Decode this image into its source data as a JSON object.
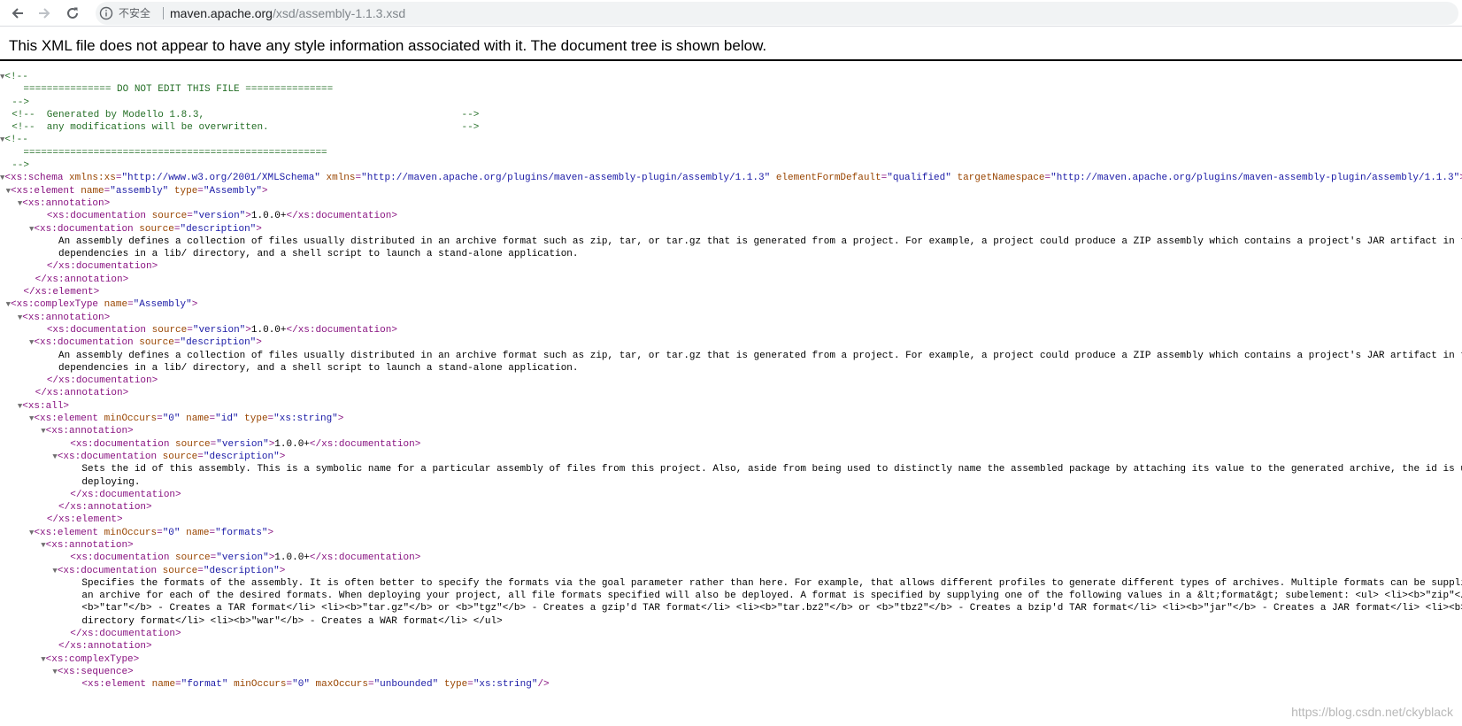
{
  "browser": {
    "back_icon": "arrow-left-icon",
    "forward_icon": "arrow-right-icon",
    "reload_icon": "reload-icon",
    "info_icon": "info-circle-icon",
    "security_label": "不安全",
    "url_host": "maven.apache.org",
    "url_path": "/xsd/assembly-1.1.3.xsd"
  },
  "viewer": {
    "header": "This XML file does not appear to have any style information associated with it. The document tree is shown below."
  },
  "xml_lines": [
    {
      "fold": true,
      "segments": [
        [
          "c",
          "<!--"
        ]
      ]
    },
    {
      "indent": "   ",
      "segments": [
        [
          "c",
          "=============== DO NOT EDIT THIS FILE ==============="
        ]
      ]
    },
    {
      "indent": " ",
      "segments": [
        [
          "c",
          "-->"
        ]
      ]
    },
    {
      "indent": " ",
      "segments": [
        [
          "c",
          "<!--  Generated by Modello 1.8.3,                                            -->"
        ]
      ]
    },
    {
      "indent": " ",
      "segments": [
        [
          "c",
          "<!--  any modifications will be overwritten.                                 -->"
        ]
      ]
    },
    {
      "fold": true,
      "segments": [
        [
          "c",
          "<!--"
        ]
      ]
    },
    {
      "indent": "   ",
      "segments": [
        [
          "c",
          "===================================================="
        ]
      ]
    },
    {
      "indent": " ",
      "segments": [
        [
          "c",
          "-->"
        ]
      ]
    },
    {
      "fold": true,
      "segments": [
        [
          "t",
          "<xs:schema"
        ],
        [
          "p",
          " "
        ],
        [
          "a",
          "xmlns:xs"
        ],
        [
          "t",
          "="
        ],
        [
          "v",
          "\"http://www.w3.org/2001/XMLSchema\""
        ],
        [
          "p",
          " "
        ],
        [
          "a",
          "xmlns"
        ],
        [
          "t",
          "="
        ],
        [
          "v",
          "\"http://maven.apache.org/plugins/maven-assembly-plugin/assembly/1.1.3\""
        ],
        [
          "p",
          " "
        ],
        [
          "a",
          "elementFormDefault"
        ],
        [
          "t",
          "="
        ],
        [
          "v",
          "\"qualified\""
        ],
        [
          "p",
          " "
        ],
        [
          "a",
          "targetNamespace"
        ],
        [
          "t",
          "="
        ],
        [
          "v",
          "\"http://maven.apache.org/plugins/maven-assembly-plugin/assembly/1.1.3\""
        ],
        [
          "t",
          ">"
        ]
      ]
    },
    {
      "indent": "  ",
      "fold": true,
      "segments": [
        [
          "t",
          "<xs:element"
        ],
        [
          "p",
          " "
        ],
        [
          "a",
          "name"
        ],
        [
          "t",
          "="
        ],
        [
          "v",
          "\"assembly\""
        ],
        [
          "p",
          " "
        ],
        [
          "a",
          "type"
        ],
        [
          "t",
          "="
        ],
        [
          "v",
          "\"Assembly\""
        ],
        [
          "t",
          ">"
        ]
      ]
    },
    {
      "indent": "    ",
      "fold": true,
      "segments": [
        [
          "t",
          "<xs:annotation>"
        ]
      ]
    },
    {
      "indent": "       ",
      "segments": [
        [
          "t",
          "<xs:documentation"
        ],
        [
          "p",
          " "
        ],
        [
          "a",
          "source"
        ],
        [
          "t",
          "="
        ],
        [
          "v",
          "\"version\""
        ],
        [
          "t",
          ">"
        ],
        [
          "p",
          "1.0.0+"
        ],
        [
          "t",
          "</xs:documentation>"
        ]
      ]
    },
    {
      "indent": "      ",
      "fold": true,
      "segments": [
        [
          "t",
          "<xs:documentation"
        ],
        [
          "p",
          " "
        ],
        [
          "a",
          "source"
        ],
        [
          "t",
          "="
        ],
        [
          "v",
          "\"description\""
        ],
        [
          "t",
          ">"
        ]
      ]
    },
    {
      "indent": "         ",
      "segments": [
        [
          "p",
          "An assembly defines a collection of files usually distributed in an archive format such as zip, tar, or tar.gz that is generated from a project. For example, a project could produce a ZIP assembly which contains a project's JAR artifact in the root directory, the runtime"
        ]
      ]
    },
    {
      "indent": "         ",
      "segments": [
        [
          "p",
          "dependencies in a lib/ directory, and a shell script to launch a stand-alone application."
        ]
      ]
    },
    {
      "indent": "       ",
      "segments": [
        [
          "t",
          "</xs:documentation>"
        ]
      ]
    },
    {
      "indent": "     ",
      "segments": [
        [
          "t",
          "</xs:annotation>"
        ]
      ]
    },
    {
      "indent": "   ",
      "segments": [
        [
          "t",
          "</xs:element>"
        ]
      ]
    },
    {
      "indent": "  ",
      "fold": true,
      "segments": [
        [
          "t",
          "<xs:complexType"
        ],
        [
          "p",
          " "
        ],
        [
          "a",
          "name"
        ],
        [
          "t",
          "="
        ],
        [
          "v",
          "\"Assembly\""
        ],
        [
          "t",
          ">"
        ]
      ]
    },
    {
      "indent": "    ",
      "fold": true,
      "segments": [
        [
          "t",
          "<xs:annotation>"
        ]
      ]
    },
    {
      "indent": "       ",
      "segments": [
        [
          "t",
          "<xs:documentation"
        ],
        [
          "p",
          " "
        ],
        [
          "a",
          "source"
        ],
        [
          "t",
          "="
        ],
        [
          "v",
          "\"version\""
        ],
        [
          "t",
          ">"
        ],
        [
          "p",
          "1.0.0+"
        ],
        [
          "t",
          "</xs:documentation>"
        ]
      ]
    },
    {
      "indent": "      ",
      "fold": true,
      "segments": [
        [
          "t",
          "<xs:documentation"
        ],
        [
          "p",
          " "
        ],
        [
          "a",
          "source"
        ],
        [
          "t",
          "="
        ],
        [
          "v",
          "\"description\""
        ],
        [
          "t",
          ">"
        ]
      ]
    },
    {
      "indent": "         ",
      "segments": [
        [
          "p",
          "An assembly defines a collection of files usually distributed in an archive format such as zip, tar, or tar.gz that is generated from a project. For example, a project could produce a ZIP assembly which contains a project's JAR artifact in the root directory, the runtime"
        ]
      ]
    },
    {
      "indent": "         ",
      "segments": [
        [
          "p",
          "dependencies in a lib/ directory, and a shell script to launch a stand-alone application."
        ]
      ]
    },
    {
      "indent": "       ",
      "segments": [
        [
          "t",
          "</xs:documentation>"
        ]
      ]
    },
    {
      "indent": "     ",
      "segments": [
        [
          "t",
          "</xs:annotation>"
        ]
      ]
    },
    {
      "indent": "    ",
      "fold": true,
      "segments": [
        [
          "t",
          "<xs:all>"
        ]
      ]
    },
    {
      "indent": "      ",
      "fold": true,
      "segments": [
        [
          "t",
          "<xs:element"
        ],
        [
          "p",
          " "
        ],
        [
          "a",
          "minOccurs"
        ],
        [
          "t",
          "="
        ],
        [
          "v",
          "\"0\""
        ],
        [
          "p",
          " "
        ],
        [
          "a",
          "name"
        ],
        [
          "t",
          "="
        ],
        [
          "v",
          "\"id\""
        ],
        [
          "p",
          " "
        ],
        [
          "a",
          "type"
        ],
        [
          "t",
          "="
        ],
        [
          "v",
          "\"xs:string\""
        ],
        [
          "t",
          ">"
        ]
      ]
    },
    {
      "indent": "        ",
      "fold": true,
      "segments": [
        [
          "t",
          "<xs:annotation>"
        ]
      ]
    },
    {
      "indent": "           ",
      "segments": [
        [
          "t",
          "<xs:documentation"
        ],
        [
          "p",
          " "
        ],
        [
          "a",
          "source"
        ],
        [
          "t",
          "="
        ],
        [
          "v",
          "\"version\""
        ],
        [
          "t",
          ">"
        ],
        [
          "p",
          "1.0.0+"
        ],
        [
          "t",
          "</xs:documentation>"
        ]
      ]
    },
    {
      "indent": "          ",
      "fold": true,
      "segments": [
        [
          "t",
          "<xs:documentation"
        ],
        [
          "p",
          " "
        ],
        [
          "a",
          "source"
        ],
        [
          "t",
          "="
        ],
        [
          "v",
          "\"description\""
        ],
        [
          "t",
          ">"
        ]
      ]
    },
    {
      "indent": "             ",
      "segments": [
        [
          "p",
          "Sets the id of this assembly. This is a symbolic name for a particular assembly of files from this project. Also, aside from being used to distinctly name the assembled package by attaching its value to the generated archive, the id is used as your artifact's classifier when"
        ]
      ]
    },
    {
      "indent": "             ",
      "segments": [
        [
          "p",
          "deploying."
        ]
      ]
    },
    {
      "indent": "           ",
      "segments": [
        [
          "t",
          "</xs:documentation>"
        ]
      ]
    },
    {
      "indent": "         ",
      "segments": [
        [
          "t",
          "</xs:annotation>"
        ]
      ]
    },
    {
      "indent": "       ",
      "segments": [
        [
          "t",
          "</xs:element>"
        ]
      ]
    },
    {
      "indent": "      ",
      "fold": true,
      "segments": [
        [
          "t",
          "<xs:element"
        ],
        [
          "p",
          " "
        ],
        [
          "a",
          "minOccurs"
        ],
        [
          "t",
          "="
        ],
        [
          "v",
          "\"0\""
        ],
        [
          "p",
          " "
        ],
        [
          "a",
          "name"
        ],
        [
          "t",
          "="
        ],
        [
          "v",
          "\"formats\""
        ],
        [
          "t",
          ">"
        ]
      ]
    },
    {
      "indent": "        ",
      "fold": true,
      "segments": [
        [
          "t",
          "<xs:annotation>"
        ]
      ]
    },
    {
      "indent": "           ",
      "segments": [
        [
          "t",
          "<xs:documentation"
        ],
        [
          "p",
          " "
        ],
        [
          "a",
          "source"
        ],
        [
          "t",
          "="
        ],
        [
          "v",
          "\"version\""
        ],
        [
          "t",
          ">"
        ],
        [
          "p",
          "1.0.0+"
        ],
        [
          "t",
          "</xs:documentation>"
        ]
      ]
    },
    {
      "indent": "          ",
      "fold": true,
      "segments": [
        [
          "t",
          "<xs:documentation"
        ],
        [
          "p",
          " "
        ],
        [
          "a",
          "source"
        ],
        [
          "t",
          "="
        ],
        [
          "v",
          "\"description\""
        ],
        [
          "t",
          ">"
        ]
      ]
    },
    {
      "indent": "             ",
      "segments": [
        [
          "p",
          "Specifies the formats of the assembly. It is often better to specify the formats via the goal parameter rather than here. For example, that allows different profiles to generate different types of archives. Multiple formats can be supplied and the Assembly Plugin will generate"
        ]
      ]
    },
    {
      "indent": "             ",
      "segments": [
        [
          "p",
          "an archive for each of the desired formats. When deploying your project, all file formats specified will also be deployed. A format is specified by supplying one of the following values in a &lt;format&gt; subelement: <ul> <li><b>\"zip\"</b> - Creates a ZIP file format</li> <li>"
        ]
      ]
    },
    {
      "indent": "             ",
      "segments": [
        [
          "p",
          "<b>\"tar\"</b> - Creates a TAR format</li> <li><b>\"tar.gz\"</b> or <b>\"tgz\"</b> - Creates a gzip'd TAR format</li> <li><b>\"tar.bz2\"</b> or <b>\"tbz2\"</b> - Creates a bzip'd TAR format</li> <li><b>\"jar\"</b> - Creates a JAR format</li> <li><b>\"dir\"</b> - Creates an exploded"
        ]
      ]
    },
    {
      "indent": "             ",
      "segments": [
        [
          "p",
          "directory format</li> <li><b>\"war\"</b> - Creates a WAR format</li> </ul>"
        ]
      ]
    },
    {
      "indent": "           ",
      "segments": [
        [
          "t",
          "</xs:documentation>"
        ]
      ]
    },
    {
      "indent": "         ",
      "segments": [
        [
          "t",
          "</xs:annotation>"
        ]
      ]
    },
    {
      "indent": "        ",
      "fold": true,
      "segments": [
        [
          "t",
          "<xs:complexType>"
        ]
      ]
    },
    {
      "indent": "          ",
      "fold": true,
      "segments": [
        [
          "t",
          "<xs:sequence>"
        ]
      ]
    },
    {
      "indent": "             ",
      "segments": [
        [
          "t",
          "<xs:element"
        ],
        [
          "p",
          " "
        ],
        [
          "a",
          "name"
        ],
        [
          "t",
          "="
        ],
        [
          "v",
          "\"format\""
        ],
        [
          "p",
          " "
        ],
        [
          "a",
          "minOccurs"
        ],
        [
          "t",
          "="
        ],
        [
          "v",
          "\"0\""
        ],
        [
          "p",
          " "
        ],
        [
          "a",
          "maxOccurs"
        ],
        [
          "t",
          "="
        ],
        [
          "v",
          "\"unbounded\""
        ],
        [
          "p",
          " "
        ],
        [
          "a",
          "type"
        ],
        [
          "t",
          "="
        ],
        [
          "v",
          "\"xs:string\""
        ],
        [
          "t",
          "/>"
        ]
      ]
    }
  ],
  "watermark": "https://blog.csdn.net/ckyblack",
  "colors": {
    "tag": "#881280",
    "attr_name": "#994500",
    "attr_value": "#1a1aa6",
    "comment": "#236e25",
    "text": "#000000"
  }
}
